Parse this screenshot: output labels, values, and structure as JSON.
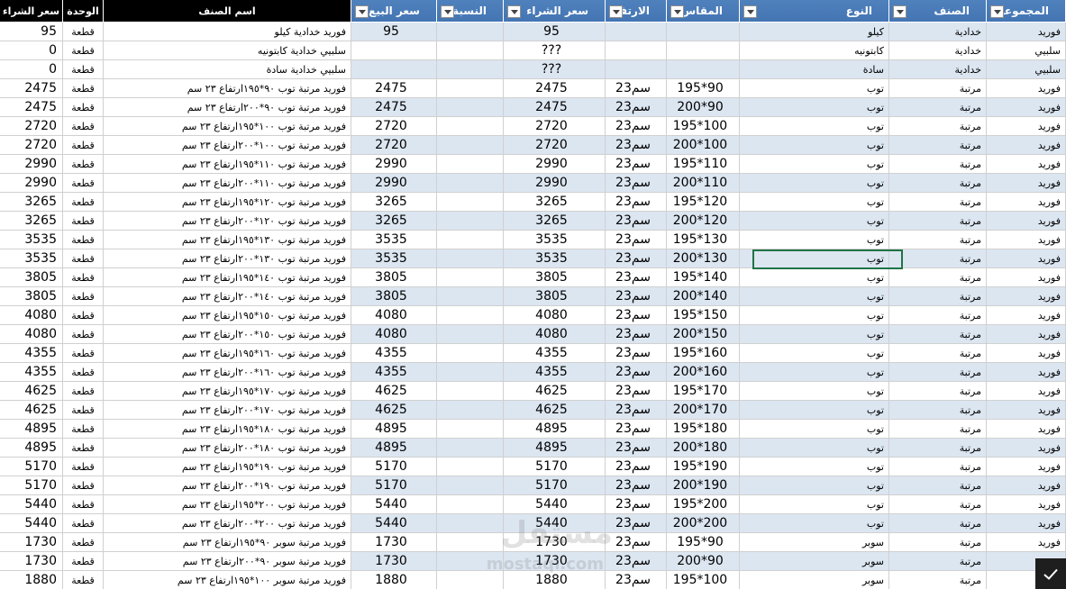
{
  "headers": [
    "سعر الشراء",
    "الوحدة",
    "اسم الصنف",
    "سعر البيع",
    "النسبة",
    "سعر الشراء",
    "الارتفاع",
    "المقاس",
    "النوع",
    "الصنف",
    "المجموعة"
  ],
  "rows": [
    [
      "95",
      "قطعة",
      "فوريد خدادية كيلو",
      "95",
      "",
      "95",
      "",
      "",
      "كيلو",
      "خدادية",
      "فوريد"
    ],
    [
      "0",
      "قطعة",
      "سلبيي خدادية كابتونيه",
      "",
      "",
      "???",
      "",
      "",
      "كابتونيه",
      "خدادية",
      "سلبيي"
    ],
    [
      "0",
      "قطعة",
      "سلبيي خدادية سادة",
      "",
      "",
      "???",
      "",
      "",
      "سادة",
      "خدادية",
      "سلبيي"
    ],
    [
      "2475",
      "قطعة",
      "فوريد مرتبة توب ٩٠*١٩٥ارتفاع ٢٣ سم",
      "2475",
      "",
      "2475",
      "23سم",
      "195*90",
      "توب",
      "مرتبة",
      "فوريد"
    ],
    [
      "2475",
      "قطعة",
      "فوريد مرتبة توب ٩٠*٢٠٠ارتفاع ٢٣ سم",
      "2475",
      "",
      "2475",
      "23سم",
      "200*90",
      "توب",
      "مرتبة",
      "فوريد"
    ],
    [
      "2720",
      "قطعة",
      "فوريد مرتبة توب ١٠٠*١٩٥ارتفاع ٢٣ سم",
      "2720",
      "",
      "2720",
      "23سم",
      "195*100",
      "توب",
      "مرتبة",
      "فوريد"
    ],
    [
      "2720",
      "قطعة",
      "فوريد مرتبة توب ١٠٠*٢٠٠ارتفاع ٢٣ سم",
      "2720",
      "",
      "2720",
      "23سم",
      "200*100",
      "توب",
      "مرتبة",
      "فوريد"
    ],
    [
      "2990",
      "قطعة",
      "فوريد مرتبة توب ١١٠*١٩٥ارتفاع ٢٣ سم",
      "2990",
      "",
      "2990",
      "23سم",
      "195*110",
      "توب",
      "مرتبة",
      "فوريد"
    ],
    [
      "2990",
      "قطعة",
      "فوريد مرتبة توب ١١٠*٢٠٠ارتفاع ٢٣ سم",
      "2990",
      "",
      "2990",
      "23سم",
      "200*110",
      "توب",
      "مرتبة",
      "فوريد"
    ],
    [
      "3265",
      "قطعة",
      "فوريد مرتبة توب ١٢٠*١٩٥ارتفاع ٢٣ سم",
      "3265",
      "",
      "3265",
      "23سم",
      "195*120",
      "توب",
      "مرتبة",
      "فوريد"
    ],
    [
      "3265",
      "قطعة",
      "فوريد مرتبة توب ١٢٠*٢٠٠ارتفاع ٢٣ سم",
      "3265",
      "",
      "3265",
      "23سم",
      "200*120",
      "توب",
      "مرتبة",
      "فوريد"
    ],
    [
      "3535",
      "قطعة",
      "فوريد مرتبة توب ١٣٠*١٩٥ارتفاع ٢٣ سم",
      "3535",
      "",
      "3535",
      "23سم",
      "195*130",
      "توب",
      "مرتبة",
      "فوريد"
    ],
    [
      "3535",
      "قطعة",
      "فوريد مرتبة توب ١٣٠*٢٠٠ارتفاع ٢٣ سم",
      "3535",
      "",
      "3535",
      "23سم",
      "200*130",
      "توب",
      "مرتبة",
      "فوريد"
    ],
    [
      "3805",
      "قطعة",
      "فوريد مرتبة توب ١٤٠*١٩٥ارتفاع ٢٣ سم",
      "3805",
      "",
      "3805",
      "23سم",
      "195*140",
      "توب",
      "مرتبة",
      "فوريد"
    ],
    [
      "3805",
      "قطعة",
      "فوريد مرتبة توب ١٤٠*٢٠٠ارتفاع ٢٣ سم",
      "3805",
      "",
      "3805",
      "23سم",
      "200*140",
      "توب",
      "مرتبة",
      "فوريد"
    ],
    [
      "4080",
      "قطعة",
      "فوريد مرتبة توب ١٥٠*١٩٥ارتفاع ٢٣ سم",
      "4080",
      "",
      "4080",
      "23سم",
      "195*150",
      "توب",
      "مرتبة",
      "فوريد"
    ],
    [
      "4080",
      "قطعة",
      "فوريد مرتبة توب ١٥٠*٢٠٠ارتفاع ٢٣ سم",
      "4080",
      "",
      "4080",
      "23سم",
      "200*150",
      "توب",
      "مرتبة",
      "فوريد"
    ],
    [
      "4355",
      "قطعة",
      "فوريد مرتبة توب ١٦٠*١٩٥ارتفاع ٢٣ سم",
      "4355",
      "",
      "4355",
      "23سم",
      "195*160",
      "توب",
      "مرتبة",
      "فوريد"
    ],
    [
      "4355",
      "قطعة",
      "فوريد مرتبة توب ١٦٠*٢٠٠ارتفاع ٢٣ سم",
      "4355",
      "",
      "4355",
      "23سم",
      "200*160",
      "توب",
      "مرتبة",
      "فوريد"
    ],
    [
      "4625",
      "قطعة",
      "فوريد مرتبة توب ١٧٠*١٩٥ارتفاع ٢٣ سم",
      "4625",
      "",
      "4625",
      "23سم",
      "195*170",
      "توب",
      "مرتبة",
      "فوريد"
    ],
    [
      "4625",
      "قطعة",
      "فوريد مرتبة توب ١٧٠*٢٠٠ارتفاع ٢٣ سم",
      "4625",
      "",
      "4625",
      "23سم",
      "200*170",
      "توب",
      "مرتبة",
      "فوريد"
    ],
    [
      "4895",
      "قطعة",
      "فوريد مرتبة توب ١٨٠*١٩٥ارتفاع ٢٣ سم",
      "4895",
      "",
      "4895",
      "23سم",
      "195*180",
      "توب",
      "مرتبة",
      "فوريد"
    ],
    [
      "4895",
      "قطعة",
      "فوريد مرتبة توب ١٨٠*٢٠٠ارتفاع ٢٣ سم",
      "4895",
      "",
      "4895",
      "23سم",
      "200*180",
      "توب",
      "مرتبة",
      "فوريد"
    ],
    [
      "5170",
      "قطعة",
      "فوريد مرتبة توب ١٩٠*١٩٥ارتفاع ٢٣ سم",
      "5170",
      "",
      "5170",
      "23سم",
      "195*190",
      "توب",
      "مرتبة",
      "فوريد"
    ],
    [
      "5170",
      "قطعة",
      "فوريد مرتبة توب ١٩٠*٢٠٠ارتفاع ٢٣ سم",
      "5170",
      "",
      "5170",
      "23سم",
      "200*190",
      "توب",
      "مرتبة",
      "فوريد"
    ],
    [
      "5440",
      "قطعة",
      "فوريد مرتبة توب ٢٠٠*١٩٥ارتفاع ٢٣ سم",
      "5440",
      "",
      "5440",
      "23سم",
      "195*200",
      "توب",
      "مرتبة",
      "فوريد"
    ],
    [
      "5440",
      "قطعة",
      "فوريد مرتبة توب ٢٠٠*٢٠٠ارتفاع ٢٣ سم",
      "5440",
      "",
      "5440",
      "23سم",
      "200*200",
      "توب",
      "مرتبة",
      "فوريد"
    ],
    [
      "1730",
      "قطعة",
      "فوريد مرتبة سوبر ٩٠*١٩٥ارتفاع ٢٣ سم",
      "1730",
      "",
      "1730",
      "23سم",
      "195*90",
      "سوبر",
      "مرتبة",
      "فوريد"
    ],
    [
      "1730",
      "قطعة",
      "فوريد مرتبة سوبر ٩٠*٢٠٠ارتفاع ٢٣ سم",
      "1730",
      "",
      "1730",
      "23سم",
      "200*90",
      "سوبر",
      "مرتبة",
      "فوريد"
    ],
    [
      "1880",
      "قطعة",
      "فوريد مرتبة سوبر ١٠٠*١٩٥ارتفاع ٢٣ سم",
      "1880",
      "",
      "1880",
      "23سم",
      "195*100",
      "سوبر",
      "مرتبة",
      "فوريد"
    ]
  ],
  "watermark": {
    "brand": "مستقل",
    "domain": "mostaql.com"
  },
  "colors": {
    "table_header": "#4f81bd",
    "band": "#dce6f1",
    "selection": "#217346"
  }
}
